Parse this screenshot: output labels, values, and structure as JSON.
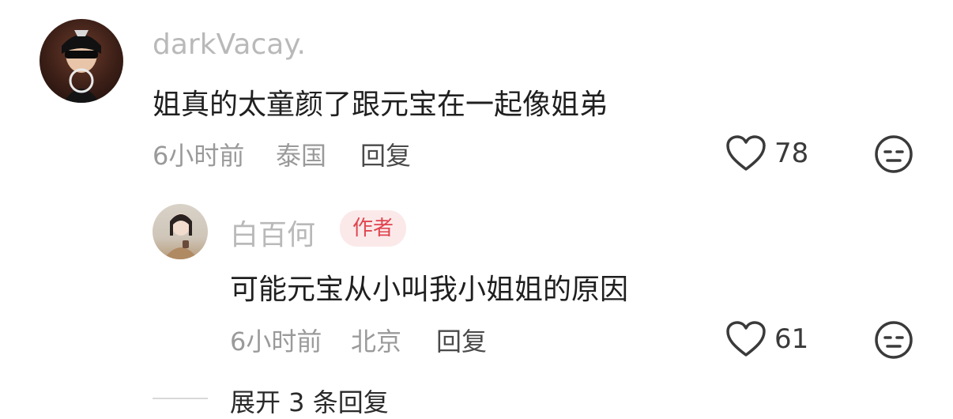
{
  "comment": {
    "username": "darkVacay.",
    "text": "姐真的太童颜了跟元宝在一起像姐弟",
    "time": "6小时前",
    "location": "泰国",
    "reply_label": "回复",
    "likes": "78"
  },
  "reply": {
    "username": "白百何",
    "badge": "作者",
    "text": "可能元宝从小叫我小姐姐的原因",
    "time": "6小时前",
    "location": "北京",
    "reply_label": "回复",
    "likes": "61"
  },
  "expand_label": "展开 3 条回复",
  "icons": {
    "like": "heart-icon",
    "dislike": "meh-face-icon"
  }
}
